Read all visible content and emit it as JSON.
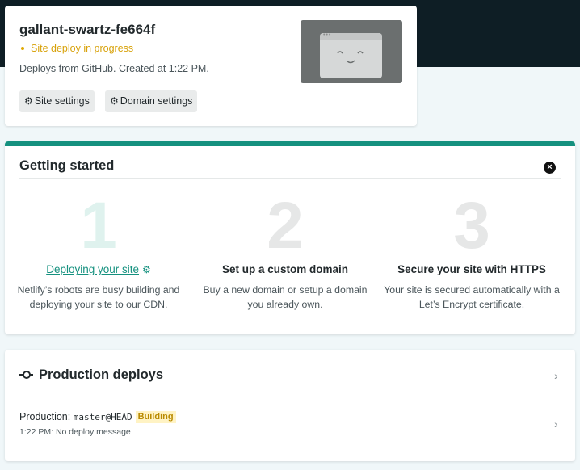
{
  "site": {
    "name": "gallant-swartz-fe664f",
    "status": "Site deploy in progress",
    "info": "Deploys from GitHub. Created at 1:22 PM.",
    "buttons": {
      "site_settings": "Site settings",
      "domain_settings": "Domain settings"
    }
  },
  "getting_started": {
    "title": "Getting started",
    "steps": [
      {
        "number": "1",
        "title": "Deploying your site",
        "desc": "Netlify’s robots are busy building and deploying your site to our CDN."
      },
      {
        "number": "2",
        "title": "Set up a custom domain",
        "desc": "Buy a new domain or setup a domain you already own."
      },
      {
        "number": "3",
        "title": "Secure your site with HTTPS",
        "desc": "Your site is secured automatically with a Let’s Encrypt certificate."
      }
    ]
  },
  "production_deploys": {
    "title": "Production deploys",
    "rows": [
      {
        "label": "Production:",
        "ref": "master@HEAD",
        "badge": "Building",
        "time": "1:22 PM:",
        "message": "No deploy message"
      }
    ]
  },
  "colors": {
    "accent": "#15917f",
    "warning": "#e0a800",
    "dark_header": "#0e1e25"
  },
  "icons": [
    "gear-icon",
    "close-icon",
    "commit-icon",
    "chevron-right-icon"
  ]
}
